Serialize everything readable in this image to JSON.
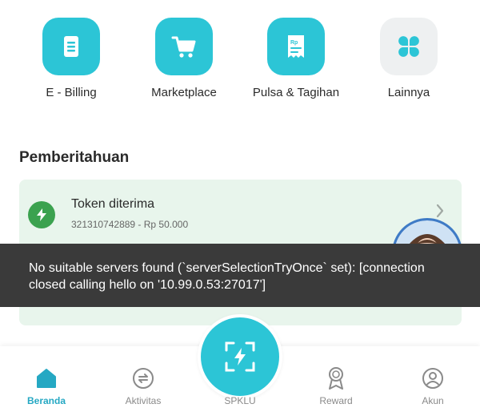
{
  "quick_menu": [
    {
      "label": "E - Billing",
      "icon": "document-icon"
    },
    {
      "label": "Marketplace",
      "icon": "shopping-cart-icon"
    },
    {
      "label": "Pulsa & Tagihan",
      "icon": "receipt-icon"
    },
    {
      "label": "Lainnya",
      "icon": "grid-icon"
    }
  ],
  "notifications": {
    "title": "Pemberitahuan",
    "items": [
      {
        "title": "Token diterima",
        "subtitle": "321310742889 - Rp 50.000",
        "icon": "lightning-icon"
      }
    ]
  },
  "toast": {
    "message": "No suitable servers found (`serverSelectionTryOnce` set): [connection closed calling hello on '10.99.0.53:27017']"
  },
  "bottom_nav": {
    "items": [
      {
        "label": "Beranda",
        "icon": "home-icon",
        "active": true
      },
      {
        "label": "Aktivitas",
        "icon": "refresh-icon",
        "active": false
      },
      {
        "label": "Reward",
        "icon": "medal-icon",
        "active": false
      },
      {
        "label": "Akun",
        "icon": "user-icon",
        "active": false
      }
    ],
    "center": {
      "label": "SPKLU",
      "icon": "ev-charge-icon"
    }
  },
  "colors": {
    "accent": "#2cc5d6",
    "active_nav": "#25a8c3",
    "success": "#3ba24f",
    "notif_bg": "#e8f5ec",
    "toast_bg": "#3a3a3a"
  }
}
